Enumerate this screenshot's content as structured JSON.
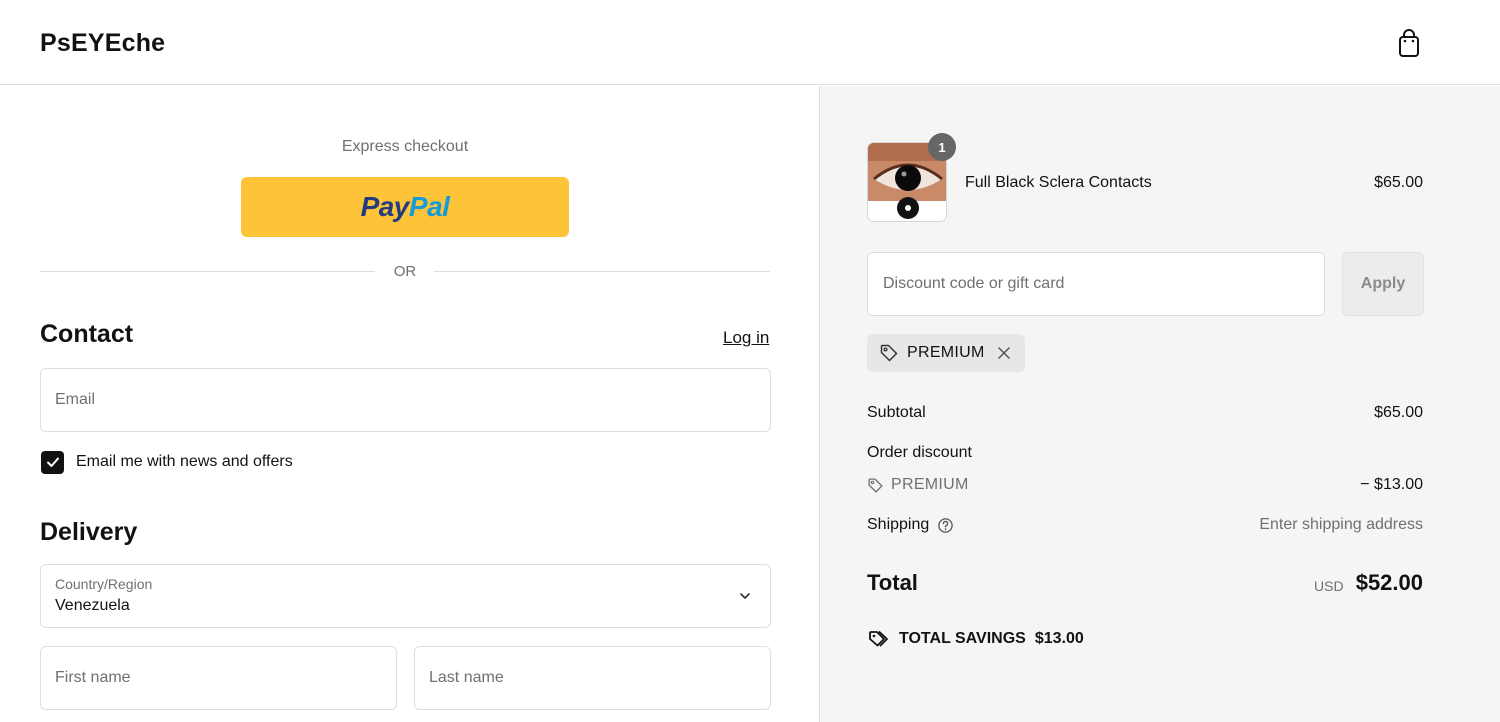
{
  "header": {
    "brand": "PsEYEche",
    "cart_icon": "shopping-bag-icon"
  },
  "express": {
    "label": "Express checkout",
    "paypal_pay": "Pay",
    "paypal_pal": "Pal",
    "or": "OR"
  },
  "contact": {
    "title": "Contact",
    "login": "Log in",
    "email_placeholder": "Email",
    "newsletter_label": "Email me with news and offers",
    "newsletter_checked": true
  },
  "delivery": {
    "title": "Delivery",
    "country_label": "Country/Region",
    "country_value": "Venezuela",
    "first_name_placeholder": "First name",
    "last_name_placeholder": "Last name"
  },
  "summary": {
    "item": {
      "quantity": "1",
      "name": "Full Black Sclera Contacts",
      "price": "$65.00"
    },
    "discount_placeholder": "Discount code or gift card",
    "apply": "Apply",
    "applied_code": "PREMIUM",
    "subtotal_label": "Subtotal",
    "subtotal_value": "$65.00",
    "order_discount_label": "Order discount",
    "discount_code": "PREMIUM",
    "discount_value": "− $13.00",
    "shipping_label": "Shipping",
    "shipping_value": "Enter shipping address",
    "total_label": "Total",
    "currency": "USD",
    "total_value": "$52.00",
    "savings_label": "TOTAL SAVINGS",
    "savings_value": "$13.00"
  },
  "colors": {
    "paypal_yellow": "#fdc439",
    "paypal_dark_blue": "#253b80",
    "paypal_light_blue": "#179bd7",
    "summary_bg": "#f5f5f5"
  }
}
